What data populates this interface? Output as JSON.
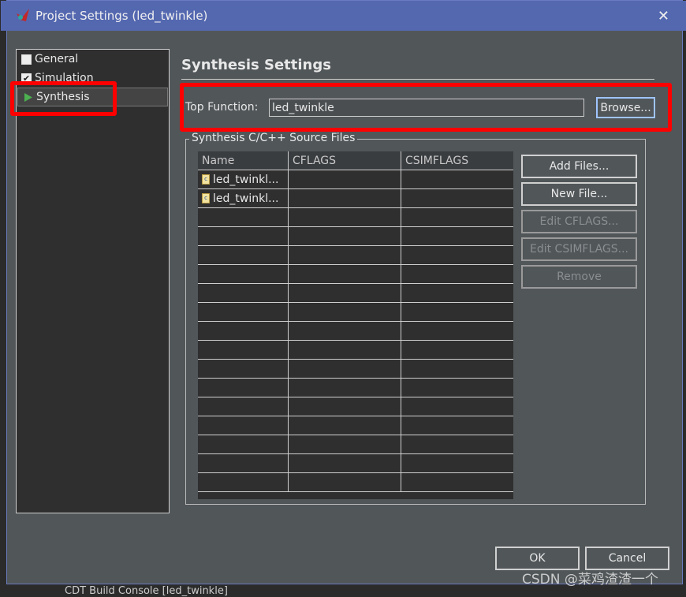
{
  "window": {
    "title": "Project Settings (led_twinkle)",
    "close": "✕"
  },
  "nav": {
    "items": [
      {
        "label": "General",
        "icon": "general-icon"
      },
      {
        "label": "Simulation",
        "icon": "checkbox-icon"
      },
      {
        "label": "Synthesis",
        "icon": "play-icon",
        "selected": true
      }
    ]
  },
  "main": {
    "heading": "Synthesis Settings",
    "top_function_label": "Top Function:",
    "top_function_value": "led_twinkle",
    "browse": "Browse...",
    "group_label": "Synthesis C/C++ Source Files",
    "columns": [
      "Name",
      "CFLAGS",
      "CSIMFLAGS"
    ],
    "rows": [
      {
        "name": "led_twinkl...",
        "cflags": "",
        "csimflags": ""
      },
      {
        "name": "led_twinkl...",
        "cflags": "",
        "csimflags": ""
      }
    ],
    "buttons": {
      "add_files": "Add Files...",
      "new_file": "New File...",
      "edit_cflags": "Edit CFLAGS...",
      "edit_csimflags": "Edit CSIMFLAGS...",
      "remove": "Remove"
    }
  },
  "footer": {
    "ok": "OK",
    "cancel": "Cancel"
  },
  "watermark": "CSDN @菜鸡渣渣一个",
  "background_console": "CDT Build Console [led_twinkle]",
  "colors": {
    "titlebar": "#5468b0",
    "dialog": "#515659",
    "highlight": "#ff0000"
  }
}
